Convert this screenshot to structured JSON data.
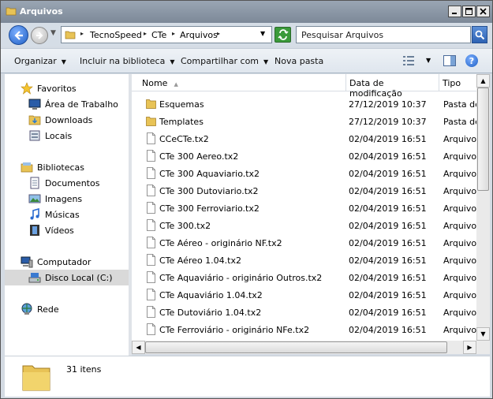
{
  "window": {
    "title": "Arquivos"
  },
  "address": {
    "crumbs": [
      "TecnoSpeed",
      "CTe",
      "Arquivos"
    ],
    "search_placeholder": "Pesquisar Arquivos"
  },
  "toolbar": {
    "organize": "Organizar",
    "include_library": "Incluir na biblioteca",
    "share": "Compartilhar com",
    "new_folder": "Nova pasta"
  },
  "nav": {
    "favorites": {
      "label": "Favoritos",
      "items": [
        "Área de Trabalho",
        "Downloads",
        "Locais"
      ]
    },
    "libraries": {
      "label": "Bibliotecas",
      "items": [
        "Documentos",
        "Imagens",
        "Músicas",
        "Vídeos"
      ]
    },
    "computer": {
      "label": "Computador",
      "items": [
        "Disco Local (C:)"
      ]
    },
    "network": {
      "label": "Rede"
    }
  },
  "columns": {
    "name": "Nome",
    "date": "Data de modificação",
    "type": "Tipo"
  },
  "files": [
    {
      "name": "Esquemas",
      "date": "27/12/2019 10:37",
      "type": "Pasta de",
      "kind": "folder"
    },
    {
      "name": "Templates",
      "date": "27/12/2019 10:37",
      "type": "Pasta de",
      "kind": "folder"
    },
    {
      "name": "CCeCTe.tx2",
      "date": "02/04/2019 16:51",
      "type": "Arquivo T",
      "kind": "file"
    },
    {
      "name": "CTe 300 Aereo.tx2",
      "date": "02/04/2019 16:51",
      "type": "Arquivo T",
      "kind": "file"
    },
    {
      "name": "CTe 300 Aquaviario.tx2",
      "date": "02/04/2019 16:51",
      "type": "Arquivo T",
      "kind": "file"
    },
    {
      "name": "CTe 300 Dutoviario.tx2",
      "date": "02/04/2019 16:51",
      "type": "Arquivo T",
      "kind": "file"
    },
    {
      "name": "CTe 300 Ferroviario.tx2",
      "date": "02/04/2019 16:51",
      "type": "Arquivo T",
      "kind": "file"
    },
    {
      "name": "CTe 300.tx2",
      "date": "02/04/2019 16:51",
      "type": "Arquivo T",
      "kind": "file"
    },
    {
      "name": "CTe Aéreo - originário NF.tx2",
      "date": "02/04/2019 16:51",
      "type": "Arquivo T",
      "kind": "file"
    },
    {
      "name": "CTe Aéreo 1.04.tx2",
      "date": "02/04/2019 16:51",
      "type": "Arquivo T",
      "kind": "file"
    },
    {
      "name": "CTe Aquaviário - originário Outros.tx2",
      "date": "02/04/2019 16:51",
      "type": "Arquivo T",
      "kind": "file"
    },
    {
      "name": "CTe Aquaviário 1.04.tx2",
      "date": "02/04/2019 16:51",
      "type": "Arquivo T",
      "kind": "file"
    },
    {
      "name": "CTe Dutoviário 1.04.tx2",
      "date": "02/04/2019 16:51",
      "type": "Arquivo T",
      "kind": "file"
    },
    {
      "name": "CTe Ferroviário - originário NFe.tx2",
      "date": "02/04/2019 16:51",
      "type": "Arquivo T",
      "kind": "file"
    }
  ],
  "status": {
    "count": "31 itens"
  }
}
